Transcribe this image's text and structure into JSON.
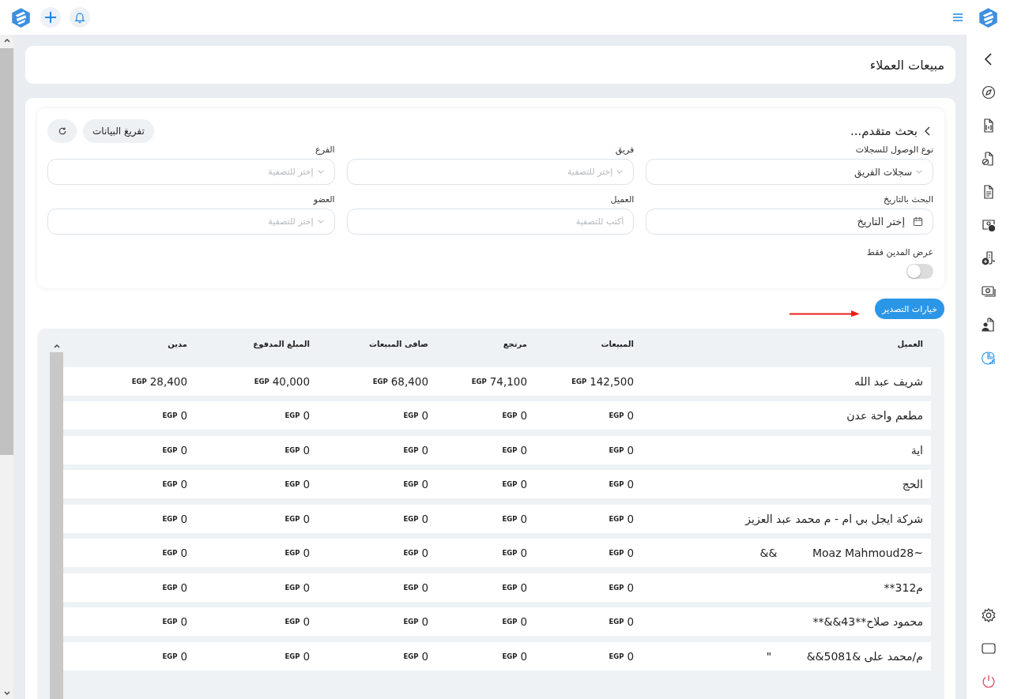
{
  "page_title": "مبيعات العملاء",
  "filter": {
    "title": "بحث متقدم...",
    "clear_button": "تفريغ البيانات",
    "fields": [
      {
        "label": "نوع الوصول للسجلات",
        "kind": "select",
        "value": "سجلات الفريق"
      },
      {
        "label": "فريق",
        "kind": "select",
        "placeholder": "إختر للتصفية"
      },
      {
        "label": "الفرع",
        "kind": "select",
        "placeholder": "إختر للتصفية"
      },
      {
        "label": "البحث بالتاريخ",
        "kind": "date",
        "value": "إختر التاريخ"
      },
      {
        "label": "العميل",
        "kind": "text",
        "placeholder": "أكتب للتصفية"
      },
      {
        "label": "العضو",
        "kind": "select",
        "placeholder": "إختر للتصفية"
      }
    ],
    "toggle": {
      "label": "عرض المدين فقط",
      "on": false
    }
  },
  "export_button": "خيارات التصدير",
  "table": {
    "columns": [
      "العميل",
      "المبيعات",
      "مرتجع",
      "صافى المبيعات",
      "المبلغ المدفوع",
      "مدين"
    ],
    "rows": [
      {
        "cells": [
          {
            "kind": "name",
            "text": "شريف عبد الله"
          },
          {
            "kind": "money",
            "currency": "EGP",
            "amount": "142,500"
          },
          {
            "kind": "money",
            "currency": "EGP",
            "amount": "74,100"
          },
          {
            "kind": "money",
            "currency": "EGP",
            "amount": "68,400"
          },
          {
            "kind": "money",
            "currency": "EGP",
            "amount": "40,000"
          },
          {
            "kind": "money",
            "currency": "EGP",
            "amount": "28,400"
          }
        ]
      },
      {
        "cells": [
          {
            "kind": "name",
            "text": "مطعم واحة عدن"
          },
          {
            "kind": "money",
            "currency": "EGP",
            "amount": "0"
          },
          {
            "kind": "money",
            "currency": "EGP",
            "amount": "0"
          },
          {
            "kind": "money",
            "currency": "EGP",
            "amount": "0"
          },
          {
            "kind": "money",
            "currency": "EGP",
            "amount": "0"
          },
          {
            "kind": "money",
            "currency": "EGP",
            "amount": "0"
          }
        ]
      },
      {
        "cells": [
          {
            "kind": "name",
            "text": "اية"
          },
          {
            "kind": "money",
            "currency": "EGP",
            "amount": "0"
          },
          {
            "kind": "money",
            "currency": "EGP",
            "amount": "0"
          },
          {
            "kind": "money",
            "currency": "EGP",
            "amount": "0"
          },
          {
            "kind": "money",
            "currency": "EGP",
            "amount": "0"
          },
          {
            "kind": "money",
            "currency": "EGP",
            "amount": "0"
          }
        ]
      },
      {
        "cells": [
          {
            "kind": "name",
            "text": "الحج"
          },
          {
            "kind": "money",
            "currency": "EGP",
            "amount": "0"
          },
          {
            "kind": "money",
            "currency": "EGP",
            "amount": "0"
          },
          {
            "kind": "money",
            "currency": "EGP",
            "amount": "0"
          },
          {
            "kind": "money",
            "currency": "EGP",
            "amount": "0"
          },
          {
            "kind": "money",
            "currency": "EGP",
            "amount": "0"
          }
        ]
      },
      {
        "cells": [
          {
            "kind": "name",
            "text": "شركة ايجل بي ام - م محمد عبد العزيز"
          },
          {
            "kind": "money",
            "currency": "EGP",
            "amount": "0"
          },
          {
            "kind": "money",
            "currency": "EGP",
            "amount": "0"
          },
          {
            "kind": "money",
            "currency": "EGP",
            "amount": "0"
          },
          {
            "kind": "money",
            "currency": "EGP",
            "amount": "0"
          },
          {
            "kind": "money",
            "currency": "EGP",
            "amount": "0"
          }
        ]
      },
      {
        "cells": [
          {
            "kind": "name",
            "text": "~Moaz Mahmoud28          &&"
          },
          {
            "kind": "money",
            "currency": "EGP",
            "amount": "0"
          },
          {
            "kind": "money",
            "currency": "EGP",
            "amount": "0"
          },
          {
            "kind": "money",
            "currency": "EGP",
            "amount": "0"
          },
          {
            "kind": "money",
            "currency": "EGP",
            "amount": "0"
          },
          {
            "kind": "money",
            "currency": "EGP",
            "amount": "0"
          }
        ]
      },
      {
        "cells": [
          {
            "kind": "name",
            "text": "م312**"
          },
          {
            "kind": "money",
            "currency": "EGP",
            "amount": "0"
          },
          {
            "kind": "money",
            "currency": "EGP",
            "amount": "0"
          },
          {
            "kind": "money",
            "currency": "EGP",
            "amount": "0"
          },
          {
            "kind": "money",
            "currency": "EGP",
            "amount": "0"
          },
          {
            "kind": "money",
            "currency": "EGP",
            "amount": "0"
          }
        ]
      },
      {
        "cells": [
          {
            "kind": "name",
            "text": "محمود صلاح**43&&**"
          },
          {
            "kind": "money",
            "currency": "EGP",
            "amount": "0"
          },
          {
            "kind": "money",
            "currency": "EGP",
            "amount": "0"
          },
          {
            "kind": "money",
            "currency": "EGP",
            "amount": "0"
          },
          {
            "kind": "money",
            "currency": "EGP",
            "amount": "0"
          },
          {
            "kind": "money",
            "currency": "EGP",
            "amount": "0"
          }
        ]
      },
      {
        "cells": [
          {
            "kind": "name",
            "text": "م/محمد على &5081&&          \""
          },
          {
            "kind": "money",
            "currency": "EGP",
            "amount": "0"
          },
          {
            "kind": "money",
            "currency": "EGP",
            "amount": "0"
          },
          {
            "kind": "money",
            "currency": "EGP",
            "amount": "0"
          },
          {
            "kind": "money",
            "currency": "EGP",
            "amount": "0"
          },
          {
            "kind": "money",
            "currency": "EGP",
            "amount": "0"
          }
        ]
      }
    ]
  },
  "sidebar": {
    "items": [
      {
        "selected": false
      },
      {
        "selected": false
      },
      {
        "selected": false
      },
      {
        "selected": false
      },
      {
        "selected": false
      },
      {
        "selected": false
      },
      {
        "selected": false
      },
      {
        "selected": false
      },
      {
        "selected": true
      }
    ]
  }
}
